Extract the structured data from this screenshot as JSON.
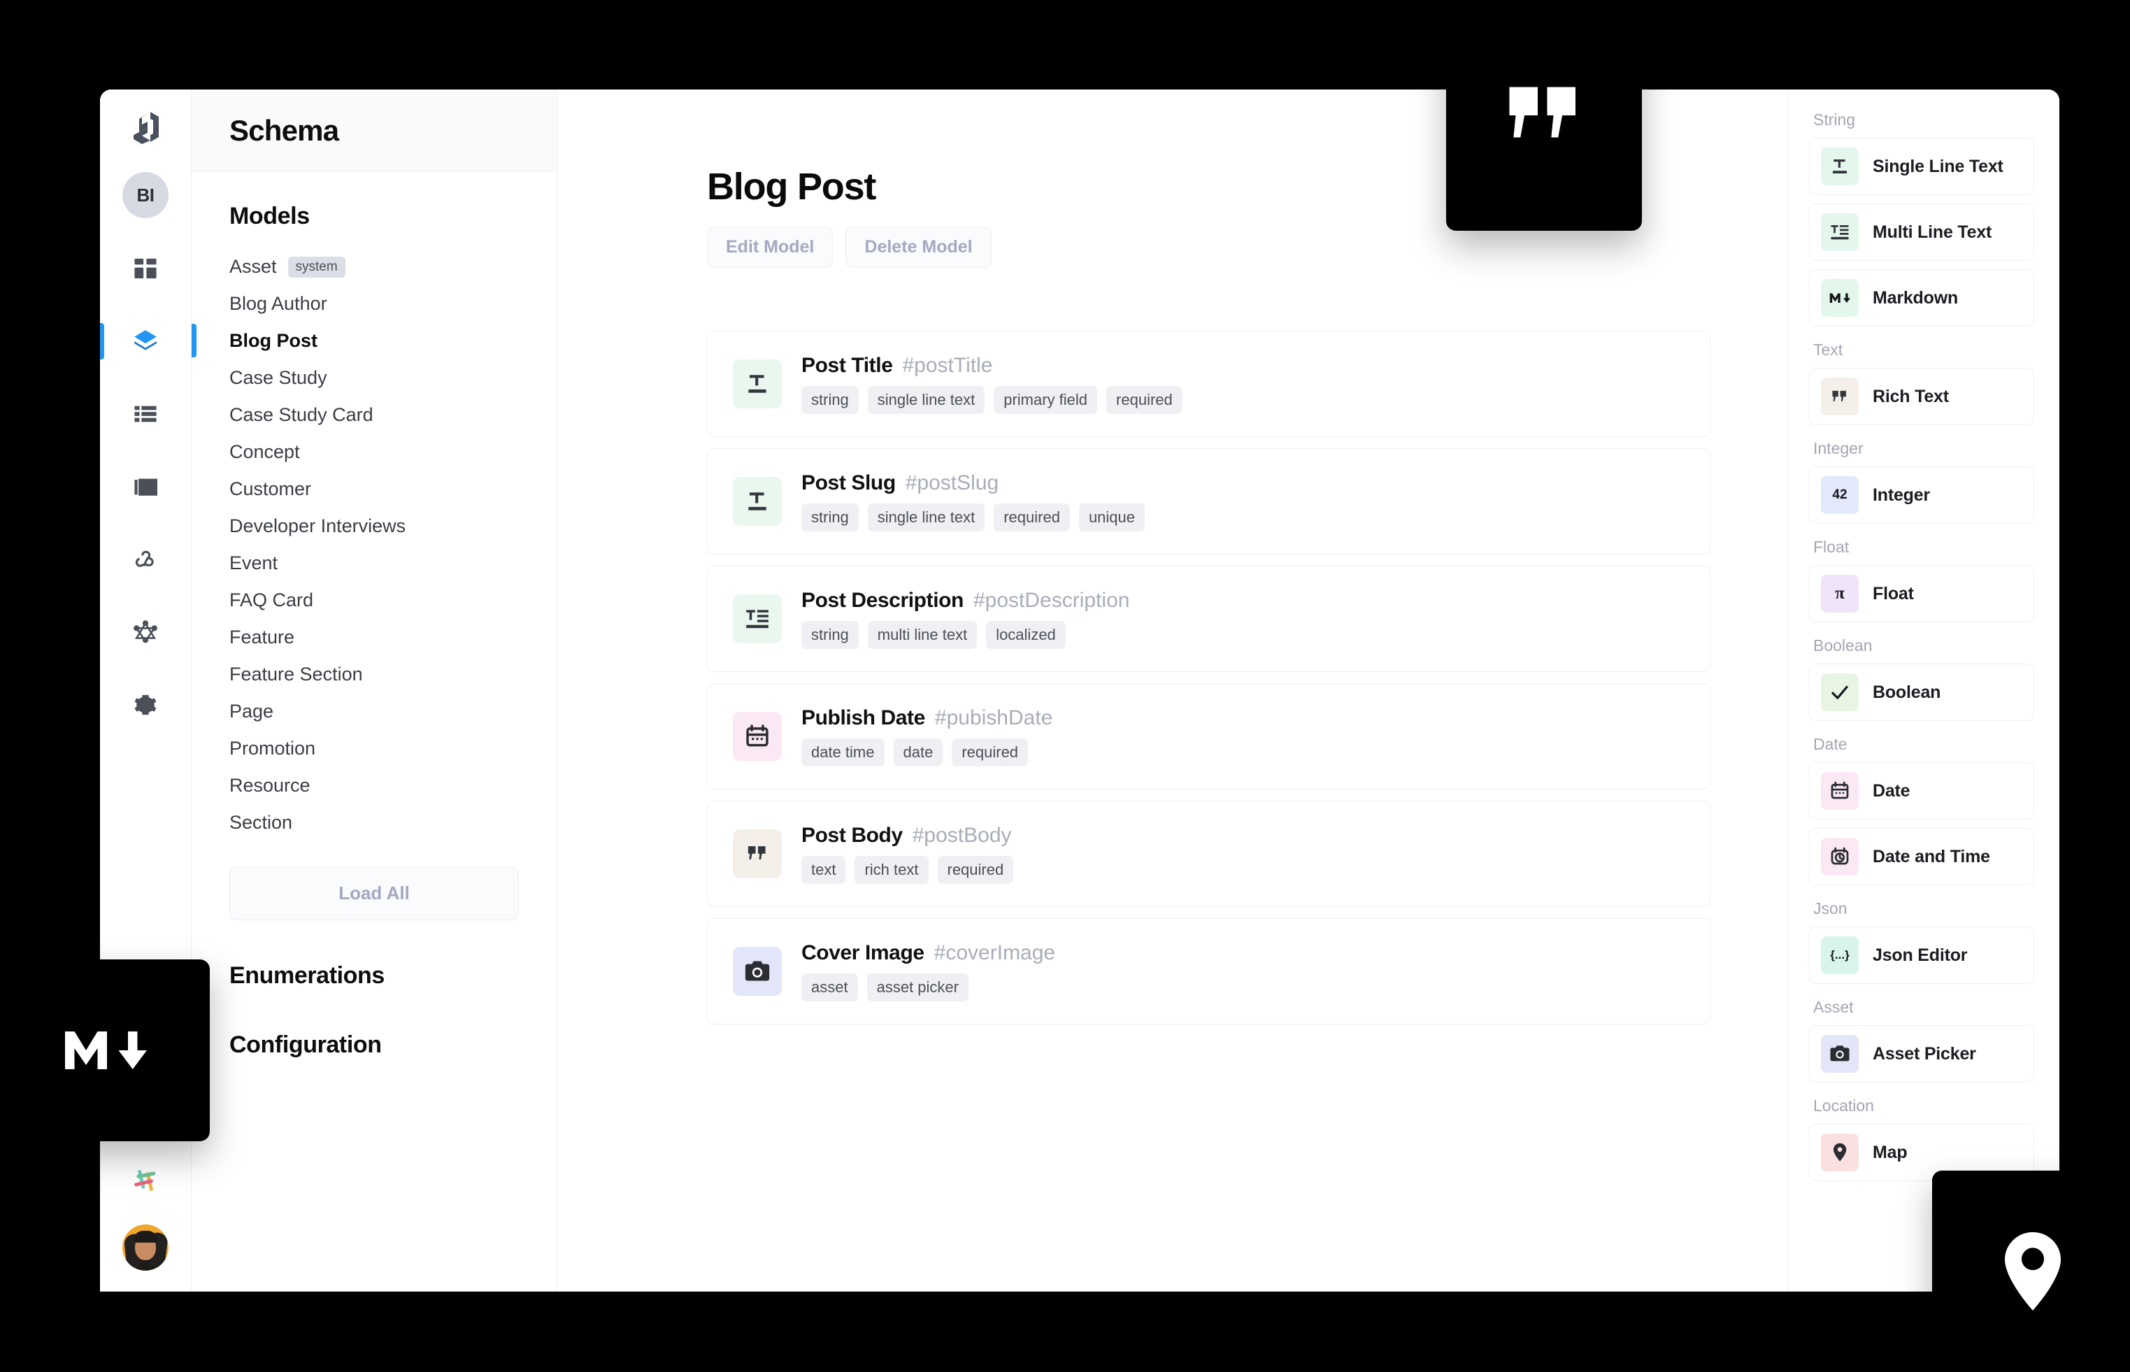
{
  "app": {
    "logo_icon": "graphcms-logo-icon",
    "project_avatar_initials": "BI",
    "rail_icons": [
      {
        "name": "dashboard-icon",
        "active": false
      },
      {
        "name": "schema-layers-icon",
        "active": true
      },
      {
        "name": "content-list-icon",
        "active": false
      },
      {
        "name": "assets-image-icon",
        "active": false
      },
      {
        "name": "webhooks-icon",
        "active": false
      },
      {
        "name": "graphql-api-icon",
        "active": false
      },
      {
        "name": "settings-gear-icon",
        "active": false
      }
    ],
    "bottom_icons": [
      {
        "name": "slack-icon"
      },
      {
        "name": "user-avatar"
      }
    ]
  },
  "sidebar": {
    "title": "Schema",
    "models_heading": "Models",
    "models": [
      {
        "label": "Asset",
        "badge": "system",
        "active": false
      },
      {
        "label": "Blog Author",
        "badge": "",
        "active": false
      },
      {
        "label": "Blog Post",
        "badge": "",
        "active": true
      },
      {
        "label": "Case Study",
        "badge": "",
        "active": false
      },
      {
        "label": "Case Study Card",
        "badge": "",
        "active": false
      },
      {
        "label": "Concept",
        "badge": "",
        "active": false
      },
      {
        "label": "Customer",
        "badge": "",
        "active": false
      },
      {
        "label": "Developer Interviews",
        "badge": "",
        "active": false
      },
      {
        "label": "Event",
        "badge": "",
        "active": false
      },
      {
        "label": "FAQ Card",
        "badge": "",
        "active": false
      },
      {
        "label": "Feature",
        "badge": "",
        "active": false
      },
      {
        "label": "Feature Section",
        "badge": "",
        "active": false
      },
      {
        "label": "Page",
        "badge": "",
        "active": false
      },
      {
        "label": "Promotion",
        "badge": "",
        "active": false
      },
      {
        "label": "Resource",
        "badge": "",
        "active": false
      },
      {
        "label": "Section",
        "badge": "",
        "active": false
      }
    ],
    "load_all_label": "Load All",
    "enumerations_heading": "Enumerations",
    "configuration_heading": "Configuration"
  },
  "main": {
    "title": "Blog Post",
    "edit_model_label": "Edit Model",
    "delete_model_label": "Delete Model",
    "fields": [
      {
        "label": "Post Title",
        "api_id": "#postTitle",
        "icon": "single-line-text-icon",
        "icon_bg": "#e9f7ef",
        "tags": [
          "string",
          "single line text",
          "primary field",
          "required"
        ]
      },
      {
        "label": "Post Slug",
        "api_id": "#postSlug",
        "icon": "single-line-text-icon",
        "icon_bg": "#e9f7ef",
        "tags": [
          "string",
          "single line text",
          "required",
          "unique"
        ]
      },
      {
        "label": "Post Description",
        "api_id": "#postDescription",
        "icon": "multi-line-text-icon",
        "icon_bg": "#e9f7ef",
        "tags": [
          "string",
          "multi line text",
          "localized"
        ]
      },
      {
        "label": "Publish Date",
        "api_id": "#pubishDate",
        "icon": "calendar-icon",
        "icon_bg": "#fae8f5",
        "tags": [
          "date time",
          "date",
          "required"
        ]
      },
      {
        "label": "Post Body",
        "api_id": "#postBody",
        "icon": "rich-text-quote-icon",
        "icon_bg": "#f4efe8",
        "tags": [
          "text",
          "rich text",
          "required"
        ]
      },
      {
        "label": "Cover Image",
        "api_id": "#coverImage",
        "icon": "camera-icon",
        "icon_bg": "#e3e5f8",
        "tags": [
          "asset",
          "asset picker"
        ]
      }
    ]
  },
  "type_sidebar": {
    "groups": [
      {
        "label": "String",
        "items": [
          {
            "label": "Single Line Text",
            "icon": "single-line-text-icon",
            "icon_bg": "#e3f7ec"
          },
          {
            "label": "Multi Line Text",
            "icon": "multi-line-text-icon",
            "icon_bg": "#e3f7ec"
          },
          {
            "label": "Markdown",
            "icon": "markdown-icon",
            "icon_bg": "#e3f7ec"
          }
        ]
      },
      {
        "label": "Text",
        "items": [
          {
            "label": "Rich Text",
            "icon": "rich-text-quote-icon",
            "icon_bg": "#f4efe8"
          }
        ]
      },
      {
        "label": "Integer",
        "items": [
          {
            "label": "Integer",
            "icon": "integer-42-icon",
            "icon_bg": "#e3e8fa"
          }
        ]
      },
      {
        "label": "Float",
        "items": [
          {
            "label": "Float",
            "icon": "float-pi-icon",
            "icon_bg": "#f0e4fa"
          }
        ]
      },
      {
        "label": "Boolean",
        "items": [
          {
            "label": "Boolean",
            "icon": "check-icon",
            "icon_bg": "#e8f5e4"
          }
        ]
      },
      {
        "label": "Date",
        "items": [
          {
            "label": "Date",
            "icon": "calendar-icon",
            "icon_bg": "#fae8f5"
          },
          {
            "label": "Date and Time",
            "icon": "calendar-clock-icon",
            "icon_bg": "#fae8f5"
          }
        ]
      },
      {
        "label": "Json",
        "items": [
          {
            "label": "Json Editor",
            "icon": "json-braces-icon",
            "icon_bg": "#d9f5ea"
          }
        ]
      },
      {
        "label": "Asset",
        "items": [
          {
            "label": "Asset Picker",
            "icon": "camera-icon",
            "icon_bg": "#e3e5f8"
          }
        ]
      },
      {
        "label": "Location",
        "items": [
          {
            "label": "Map",
            "icon": "map-pin-icon",
            "icon_bg": "#fae0e0"
          }
        ]
      }
    ]
  },
  "float_badges": [
    {
      "name": "rich-text-quote-badge",
      "icon": "quote-icon"
    },
    {
      "name": "markdown-badge",
      "icon": "markdown-icon"
    },
    {
      "name": "map-pin-badge",
      "icon": "map-pin-icon"
    }
  ],
  "colors": {
    "accent": "#2196f3",
    "muted_button_text": "#a6a8c0",
    "tag_bg": "#f0f0f4"
  }
}
